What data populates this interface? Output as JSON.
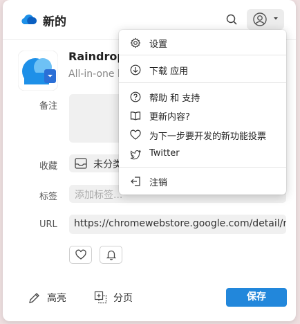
{
  "header": {
    "title": "新的",
    "search_icon": "search-icon",
    "user_icon": "user-circle-icon",
    "caret_icon": "caret-down-icon"
  },
  "item": {
    "title": "Raindrop.i",
    "description": "All-in-one b"
  },
  "fields": {
    "note_label": "备注",
    "collection_label": "收藏",
    "collection_value": "未分类",
    "tags_label": "标签",
    "tags_placeholder": "添加标签...",
    "url_label": "URL",
    "url_value": "https://chromewebstore.google.com/detail/r"
  },
  "footer": {
    "highlight_label": "高亮",
    "page_label": "分页",
    "save_label": "保存"
  },
  "menu": {
    "settings": "设置",
    "download_app": "下载 应用",
    "help": "帮助 和 支持",
    "whats_new": "更新内容?",
    "vote": "为下一步要开发的新功能投票",
    "twitter": "Twitter",
    "logout": "注销"
  },
  "colors": {
    "accent": "#2287db",
    "logo": "#1e90e8"
  }
}
